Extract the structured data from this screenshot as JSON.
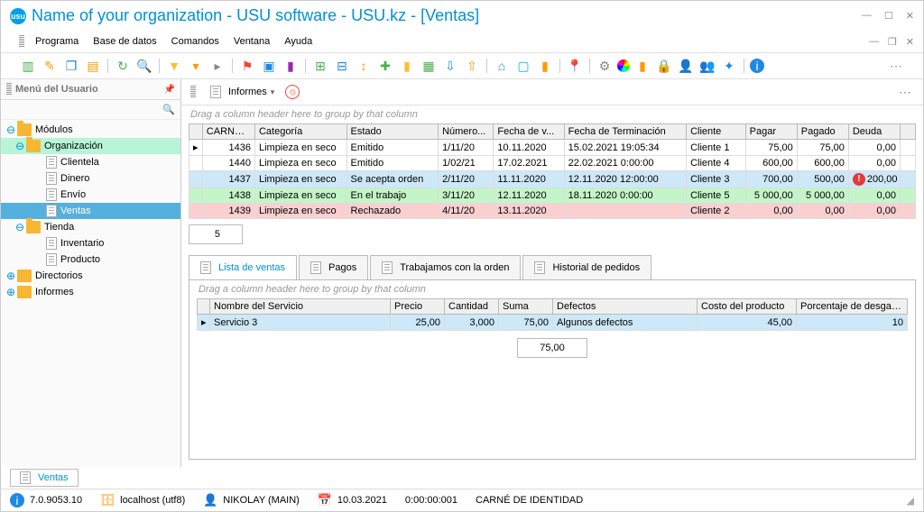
{
  "title": "Name of your organization - USU software - USU.kz - [Ventas]",
  "menu": {
    "programa": "Programa",
    "base": "Base de datos",
    "comandos": "Comandos",
    "ventana": "Ventana",
    "ayuda": "Ayuda"
  },
  "sidebar": {
    "title": "Menú del Usuario",
    "items": {
      "modulos": "Módulos",
      "organizacion": "Organización",
      "clientela": "Clientela",
      "dinero": "Dinero",
      "envio": "Envío",
      "ventas": "Ventas",
      "tienda": "Tienda",
      "inventario": "Inventario",
      "producto": "Producto",
      "directorios": "Directorios",
      "informes": "Informes"
    }
  },
  "reports": {
    "label": "Informes"
  },
  "grid1": {
    "group_hint": "Drag a column header here to group by that column",
    "headers": {
      "id": "CARNÉ ...",
      "cat": "Categoría",
      "est": "Estado",
      "num": "Número...",
      "fventa": "Fecha de v...",
      "fterm": "Fecha de Terminación",
      "cli": "Cliente",
      "pagar": "Pagar",
      "pagado": "Pagado",
      "deuda": "Deuda"
    },
    "rows": [
      {
        "id": "1436",
        "cat": "Limpieza en seco",
        "est": "Emitido",
        "num": "1/11/20",
        "fv": "10.11.2020",
        "ft": "15.02.2021 19:05:34",
        "cli": "Cliente 1",
        "pagar": "75,00",
        "pagado": "75,00",
        "deuda": "0,00",
        "cls": ""
      },
      {
        "id": "1440",
        "cat": "Limpieza en seco",
        "est": "Emitido",
        "num": "1/02/21",
        "fv": "17.02.2021",
        "ft": "22.02.2021 0:00:00",
        "cli": "Cliente 4",
        "pagar": "600,00",
        "pagado": "600,00",
        "deuda": "0,00",
        "cls": ""
      },
      {
        "id": "1437",
        "cat": "Limpieza en seco",
        "est": "Se acepta orden",
        "num": "2/11/20",
        "fv": "11.11.2020",
        "ft": "12.11.2020 12:00:00",
        "cli": "Cliente 3",
        "pagar": "700,00",
        "pagado": "500,00",
        "deuda": "200,00",
        "cls": "sel",
        "warn": true
      },
      {
        "id": "1438",
        "cat": "Limpieza en seco",
        "est": "En el trabajo",
        "num": "3/11/20",
        "fv": "12.11.2020",
        "ft": "18.11.2020 0:00:00",
        "cli": "Cliente 5",
        "pagar": "5 000,00",
        "pagado": "5 000,00",
        "deuda": "0,00",
        "cls": "ok"
      },
      {
        "id": "1439",
        "cat": "Limpieza en seco",
        "est": "Rechazado",
        "num": "4/11/20",
        "fv": "13.11.2020",
        "ft": "",
        "cli": "Cliente 2",
        "pagar": "0,00",
        "pagado": "0,00",
        "deuda": "0,00",
        "cls": "bad"
      }
    ],
    "count": "5"
  },
  "dtabs": {
    "lista": "Lista de ventas",
    "pagos": "Pagos",
    "trabaj": "Trabajamos con la orden",
    "hist": "Historial de pedidos"
  },
  "grid2": {
    "group_hint": "Drag a column header here to group by that column",
    "headers": {
      "nom": "Nombre del Servicio",
      "precio": "Precio",
      "cant": "Cantidad",
      "suma": "Suma",
      "def": "Defectos",
      "costo": "Costo del producto",
      "pct": "Porcentaje de desgaste del pr..."
    },
    "rows": [
      {
        "nom": "Servicio 3",
        "precio": "25,00",
        "cant": "3,000",
        "suma": "75,00",
        "def": "Algunos defectos",
        "costo": "45,00",
        "pct": "10"
      }
    ],
    "sum": "75,00"
  },
  "wndtab": "Ventas",
  "status": {
    "ver": "7.0.9053.10",
    "host": "localhost (utf8)",
    "user": "NIKOLAY (MAIN)",
    "date": "10.03.2021",
    "time": "0:00:00:001",
    "id": "CARNÉ DE IDENTIDAD"
  }
}
